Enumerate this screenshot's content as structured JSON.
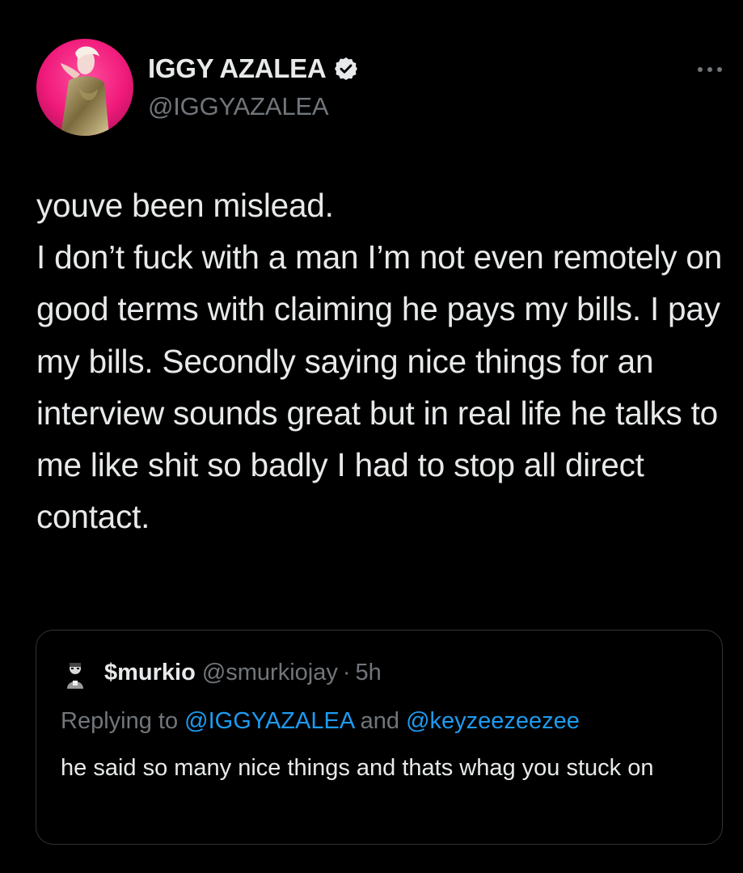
{
  "tweet": {
    "display_name": "IGGY AZALEA",
    "handle": "@IGGYAZALEA",
    "verified": true,
    "more_icon": "more-horizontal-icon",
    "text": "youve been mislead.\nI don’t fuck with a man I’m not even remotely on good terms with claiming he pays my bills. I pay my bills. Secondly saying nice things for an interview sounds great but in real life he talks to me like shit so badly I had to stop all direct contact."
  },
  "quoted": {
    "display_name": "$murkio",
    "handle": "@smurkiojay",
    "separator": "·",
    "time": "5h",
    "replying_to_label": "Replying to",
    "mention_1": "@IGGYAZALEA",
    "and_label": "and",
    "mention_2": "@keyzeezeezee",
    "text": "he said so many nice things and thats whag you stuck on"
  },
  "colors": {
    "background": "#000000",
    "text": "#e7e9ea",
    "secondary": "#71767b",
    "link": "#1d9bf0",
    "border": "#2f3336"
  }
}
